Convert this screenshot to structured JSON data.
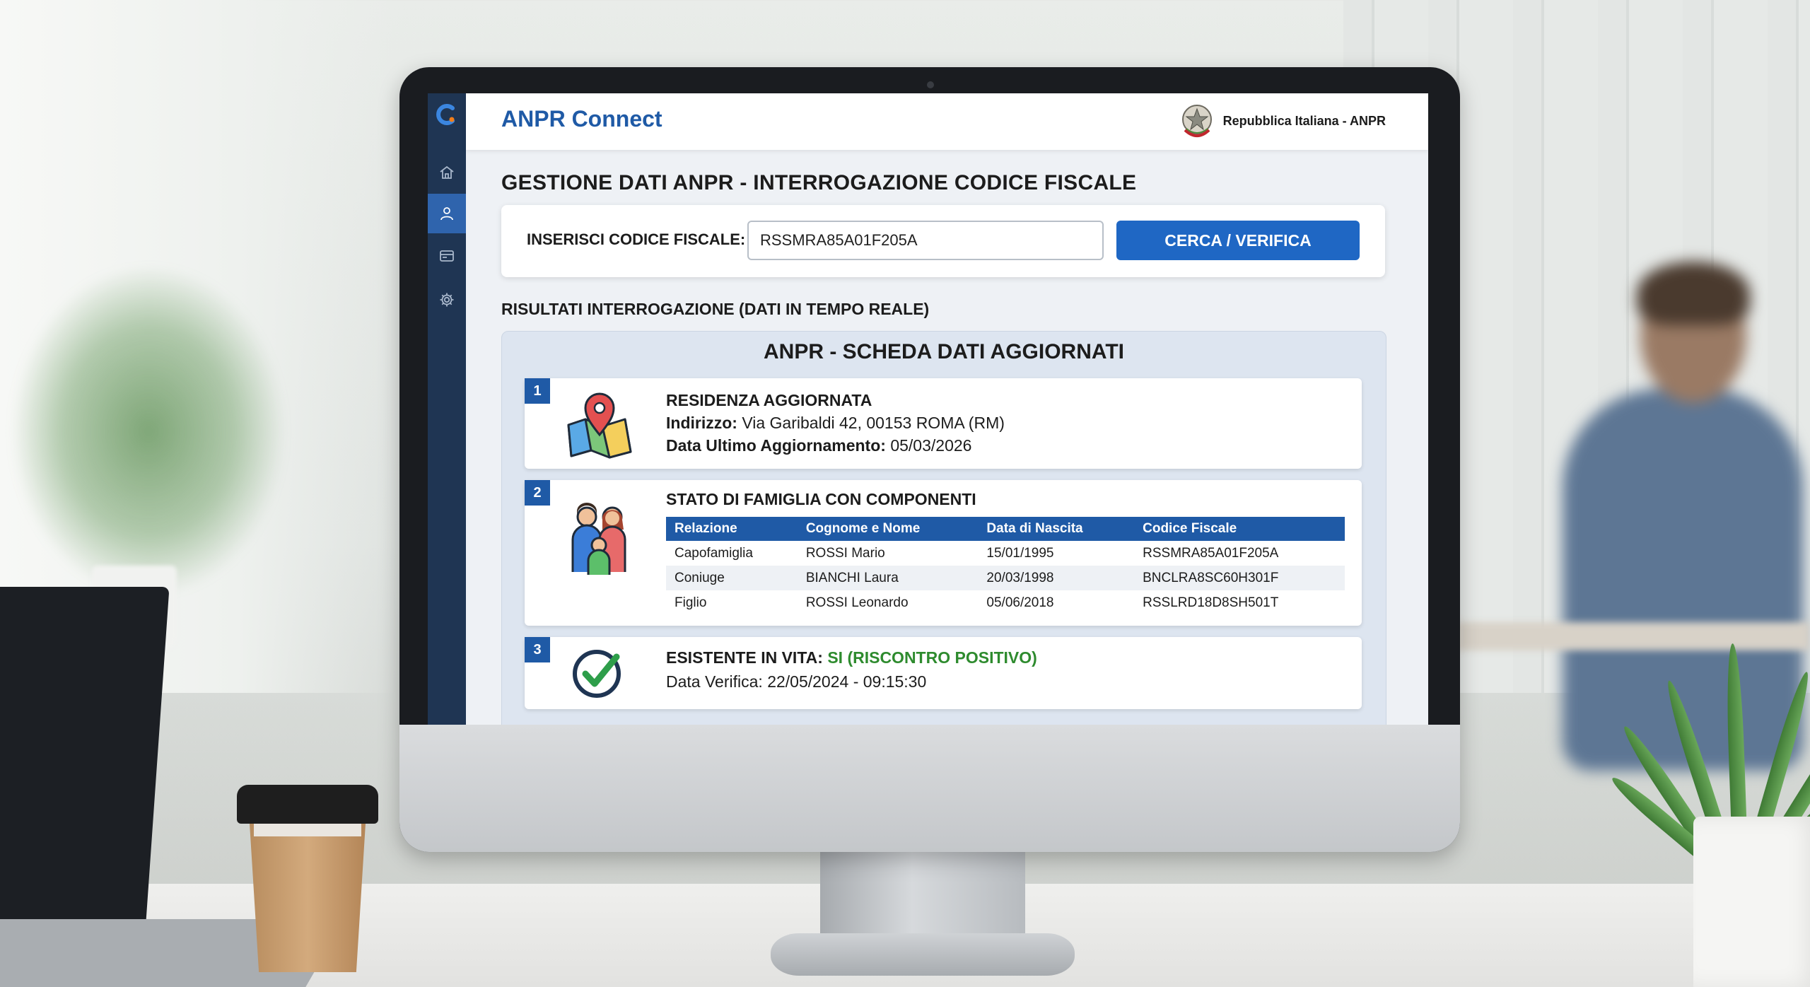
{
  "app": {
    "name": "ANPR Connect",
    "authority": "Repubblica Italiana - ANPR"
  },
  "sidebar": {
    "items": [
      {
        "icon": "home-icon",
        "active": false
      },
      {
        "icon": "user-icon",
        "active": true
      },
      {
        "icon": "card-icon",
        "active": false
      },
      {
        "icon": "gear-icon",
        "active": false
      }
    ]
  },
  "page": {
    "title": "GESTIONE DATI ANPR - INTERROGAZIONE CODICE FISCALE"
  },
  "search": {
    "label": "INSERISCI CODICE FISCALE:",
    "value": "RSSMRA85A01F205A",
    "button": "CERCA / VERIFICA"
  },
  "results": {
    "title": "RISULTATI INTERROGAZIONE (DATI IN TEMPO REALE)",
    "panel_title": "ANPR - SCHEDA DATI AGGIORNATI",
    "residence": {
      "number": "1",
      "heading": "RESIDENZA AGGIORNATA",
      "address_label": "Indirizzo:",
      "address": "Via Garibaldi 42, 00153 ROMA (RM)",
      "updated_label": "Data Ultimo Aggiornamento:",
      "updated": "05/03/2026"
    },
    "family": {
      "number": "2",
      "heading": "STATO DI FAMIGLIA CON COMPONENTI",
      "columns": [
        "Relazione",
        "Cognome e Nome",
        "Data di Nascita",
        "Codice Fiscale"
      ],
      "rows": [
        [
          "Capofamiglia",
          "ROSSI Mario",
          "15/01/1995",
          "RSSMRA85A01F205A"
        ],
        [
          "Coniuge",
          "BIANCHI Laura",
          "20/03/1998",
          "BNCLRA8SC60H301F"
        ],
        [
          "Figlio",
          "ROSSI Leonardo",
          "05/06/2018",
          "RSSLRD18D8SH501T"
        ]
      ]
    },
    "alive": {
      "number": "3",
      "heading": "ESISTENTE IN VITA:",
      "status": "SI (RISCONTRO POSITIVO)",
      "date_label": "Data Verifica:",
      "date": "22/05/2024 - 09:15:30"
    }
  },
  "colors": {
    "primary": "#1f5aa6",
    "button": "#1f67c4",
    "sidebar": "#1f3553",
    "positive": "#2e8b2e"
  }
}
